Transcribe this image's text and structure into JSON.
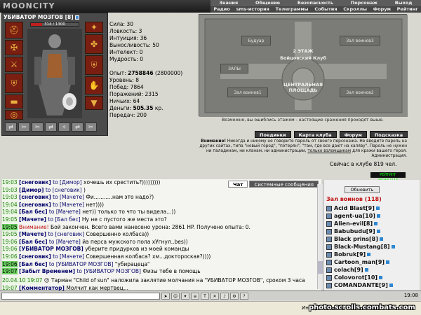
{
  "brand": {
    "logo": "MOONCITY"
  },
  "menu_top": [
    "Знания",
    "Общение",
    "Безопасность",
    "Персонаж",
    "Выход"
  ],
  "menu_bottom": [
    "Радио",
    "sms-история",
    "Телеграммы",
    "События",
    "Скроллы",
    "Форум",
    "Рейтинг"
  ],
  "character": {
    "name": "УБИВАТОР МОЗГОВ",
    "level_badge": "[8]",
    "hp_text": "314 / 1300",
    "hp_fraction": 0.24,
    "stats": [
      {
        "label": "Сила:",
        "value": "30"
      },
      {
        "label": "Ловкость:",
        "value": "3"
      },
      {
        "label": "Интуиция:",
        "value": "36"
      },
      {
        "label": "Выносливость:",
        "value": "50"
      },
      {
        "label": "Интелект:",
        "value": "0"
      },
      {
        "label": "Мудрость:",
        "value": "0"
      }
    ],
    "stats2": [
      {
        "label": "Опыт:",
        "value": "2758846",
        "extra": "(2800000)"
      },
      {
        "label": "Уровень:",
        "value": "8",
        "extra": ""
      },
      {
        "label": "Побед:",
        "value": "7864",
        "extra": ""
      },
      {
        "label": "Поражений:",
        "value": "2315",
        "extra": ""
      },
      {
        "label": "Ничьих:",
        "value": "64",
        "extra": ""
      },
      {
        "label": "Деньги:",
        "value": "505.35",
        "extra": "кр."
      },
      {
        "label": "Передач:",
        "value": "200",
        "extra": ""
      }
    ]
  },
  "map": {
    "halls": [
      "Будуар",
      "Зал воинов3",
      "ЗАЛЫ",
      "Зал воинов1",
      "Зал воинов2"
    ],
    "labels": [
      "2 ЭТАЖ",
      "Бойцовский Клуб",
      "ЦЕНТРАЛЬНАЯ",
      "ПЛОЩАДЬ"
    ],
    "caption": "Возможно, вы ошиблись этажом - настоящие сражения проходят выше."
  },
  "buttons": [
    "Поединки",
    "Карта клуба",
    "Форум",
    "Подсказка"
  ],
  "notice": {
    "bold": "Внимание!",
    "text": "Никогда и никому не говорите пароль от своего персонажа. Не вводите пароль на других сайтах, типа \"новый город\", \"потерян\", \"там, где все дают на халяву\". Пароль не нужен ни паладинам, ни кланам, ни администрации,",
    "link": "только взломщикам",
    "text2": "для кражи вашего героя.",
    "sign": "Администрация."
  },
  "online": "Сейчас в клубе 819 чел.",
  "counter": "РЕЙТИНГ 459652116",
  "chat": {
    "tabs": [
      "Чат",
      "Системные сообщения"
    ],
    "messages": [
      {
        "time": "19:03",
        "from": "[снеговик]",
        "to": "to [Димор]",
        "text": "хочешь их срестить?)))))))))",
        "hl": false
      },
      {
        "time": "19:03",
        "from": "[Димор]",
        "to": "to [снеговик]",
        "text": ")",
        "hl": false
      },
      {
        "time": "19:03",
        "from": "[снеговик]",
        "to": "to [Мачете]",
        "text": "Фи...........нам это надо?)",
        "hl": false
      },
      {
        "time": "19:04",
        "from": "[снеговик]",
        "to": "to [Мачете]",
        "text": "нет))))",
        "hl": false
      },
      {
        "time": "19:04",
        "from": "[Бал бес]",
        "to": "to [Мачете]",
        "text": "нет)) только то что ты видела...))",
        "hl": false
      },
      {
        "time": "19:05",
        "from": "[Мачете]",
        "to": "to [Бал бес]",
        "text": "Ну не с пустого же места это?",
        "hl": false
      },
      {
        "time": "19:05",
        "from": "Внимание!",
        "to": "",
        "text": "Бой закончен. Всего вами нанесено урона: 2861 HP. Получено опыта: 0.",
        "hl": true,
        "system": true
      },
      {
        "time": "19:05",
        "from": "[Мачете]",
        "to": "to [снеговик]",
        "text": "Совершенно колбаса))",
        "hl": false
      },
      {
        "time": "19:06",
        "from": "[Бал бес]",
        "to": "to [Мачете]",
        "text": "йа перса мужского пола хУгнул..bes))",
        "hl": false
      },
      {
        "time": "19:06",
        "from": "[УБИВАТОР МОЗГОВ]",
        "to": "",
        "text": "уберите придурков из моей команды",
        "hl": false
      },
      {
        "time": "19:06",
        "from": "[снеговик]",
        "to": "to [Мачете]",
        "text": "Совершенная колбаса? хм...доктороская?))))",
        "hl": false
      },
      {
        "time": "19:06",
        "from": "[Бал бес]",
        "to": "to [УБИВАТОР МОЗГОВ]",
        "text": "\"убирацеца\"",
        "hl": true
      },
      {
        "time": "19:07",
        "from": "[Забыт Временем]",
        "to": "to [УБИВАТОР МОЗГОВ]",
        "text": "Физы тебе в помощь",
        "hl": true
      }
    ],
    "system_line": {
      "time": "20.04.10 19:07",
      "text": "Тарман \"Child of sun\" наложила заклятие молчания на \"УБИВАТОР МОЗГОВ\", сроком 3 часа"
    },
    "last": {
      "time": "19:07",
      "from": "[Комментатор]",
      "text": "Молчит как мертвец..."
    }
  },
  "users": {
    "refresh": "Обновить",
    "title": "Зал воинов (118)",
    "list": [
      {
        "name": "Acid Blast",
        "lvl": "[9]"
      },
      {
        "name": "agent-ua",
        "lvl": "[10]"
      },
      {
        "name": "Alien-evil",
        "lvl": "[8]"
      },
      {
        "name": "Babubudu",
        "lvl": "[9]"
      },
      {
        "name": "Black prins",
        "lvl": "[8]"
      },
      {
        "name": "Black-Mustang",
        "lvl": "[8]"
      },
      {
        "name": "Bobruk",
        "lvl": "[9]"
      },
      {
        "name": "Cartoon_man",
        "lvl": "[9]"
      },
      {
        "name": "colach",
        "lvl": "[9]"
      },
      {
        "name": "Colovorot",
        "lvl": "[10]"
      },
      {
        "name": "COMANDANTE",
        "lvl": "[9]"
      }
    ]
  },
  "toolbar": {
    "clock": "19:08"
  },
  "statusbar": {
    "text": "Интернет"
  },
  "watermark": "photo.scrolls.combats.com"
}
